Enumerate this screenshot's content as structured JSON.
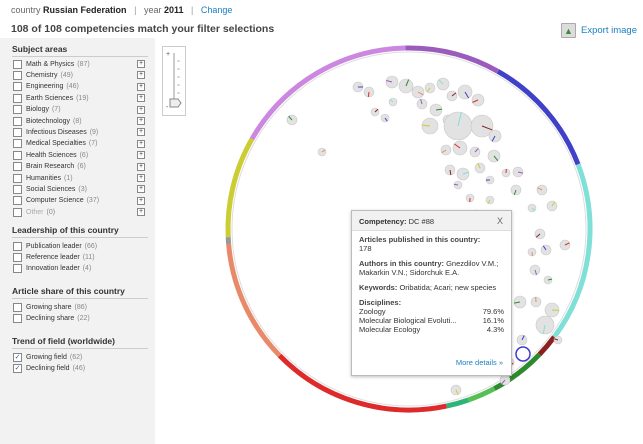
{
  "header": {
    "country_label": "country",
    "country_value": "Russian Federation",
    "year_label": "year",
    "year_value": "2011",
    "change_link": "Change",
    "headline": "108 of 108 competencies match your filter selections",
    "export_label": "Export image"
  },
  "sidebar": {
    "subject_title": "Subject areas",
    "subjects": [
      {
        "label": "Math & Physics",
        "count": "(87)",
        "dim": false
      },
      {
        "label": "Chemistry",
        "count": "(49)",
        "dim": false
      },
      {
        "label": "Engineering",
        "count": "(46)",
        "dim": false
      },
      {
        "label": "Earth Sciences",
        "count": "(19)",
        "dim": false
      },
      {
        "label": "Biology",
        "count": "(7)",
        "dim": false
      },
      {
        "label": "Biotechnology",
        "count": "(8)",
        "dim": false
      },
      {
        "label": "Infectious Diseases",
        "count": "(9)",
        "dim": false
      },
      {
        "label": "Medical Specialties",
        "count": "(7)",
        "dim": false
      },
      {
        "label": "Health Sciences",
        "count": "(6)",
        "dim": false
      },
      {
        "label": "Brain Research",
        "count": "(6)",
        "dim": false
      },
      {
        "label": "Humanities",
        "count": "(1)",
        "dim": false
      },
      {
        "label": "Social Sciences",
        "count": "(3)",
        "dim": false
      },
      {
        "label": "Computer Science",
        "count": "(37)",
        "dim": false
      },
      {
        "label": "Other",
        "count": "(0)",
        "dim": true
      }
    ],
    "leadership_title": "Leadership of this country",
    "leadership": [
      {
        "label": "Publication leader",
        "count": "(66)"
      },
      {
        "label": "Reference leader",
        "count": "(11)"
      },
      {
        "label": "Innovation leader",
        "count": "(4)"
      }
    ],
    "share_title": "Article share of this country",
    "share": [
      {
        "label": "Growing share",
        "count": "(86)"
      },
      {
        "label": "Declining share",
        "count": "(22)"
      }
    ],
    "trend_title": "Trend of field (worldwide)",
    "trend": [
      {
        "label": "Growing field",
        "count": "(62)",
        "checked": true
      },
      {
        "label": "Declining field",
        "count": "(46)",
        "checked": true
      }
    ]
  },
  "popup": {
    "competency_label": "Competency:",
    "competency_value": "DC #88",
    "close": "X",
    "articles_label": "Articles published in this country:",
    "articles_value": "178",
    "authors_label": "Authors in this country:",
    "authors_value": "Gnezdilov V.M.; Makarkin V.N.; Sidorchuk E.A.",
    "keywords_label": "Keywords:",
    "keywords_value": "Oribatida; Acari; new species",
    "disciplines_label": "Disciplines:",
    "disciplines": [
      {
        "name": "Zoology",
        "pct": "79.6%"
      },
      {
        "name": "Molecular Biological Evoluti...",
        "pct": "16.1%"
      },
      {
        "name": "Molecular Ecology",
        "pct": "4.3%"
      }
    ],
    "more": "More details »"
  },
  "ring_segments": [
    {
      "color": "#9a5bbd",
      "frac": 0.085
    },
    {
      "color": "#4040c8",
      "frac": 0.11
    },
    {
      "color": "#7fe0d8",
      "frac": 0.16
    },
    {
      "color": "#8b2020",
      "frac": 0.02
    },
    {
      "color": "#2f8a2f",
      "frac": 0.05
    },
    {
      "color": "#56c056",
      "frac": 0.025
    },
    {
      "color": "#2eb37a",
      "frac": 0.02
    },
    {
      "color": "#dd2a2a",
      "frac": 0.16
    },
    {
      "color": "#e88a6a",
      "frac": 0.11
    },
    {
      "color": "#999999",
      "frac": 0.006
    },
    {
      "color": "#cccc33",
      "frac": 0.09
    },
    {
      "color": "#cc88e0",
      "frac": 0.164
    }
  ]
}
